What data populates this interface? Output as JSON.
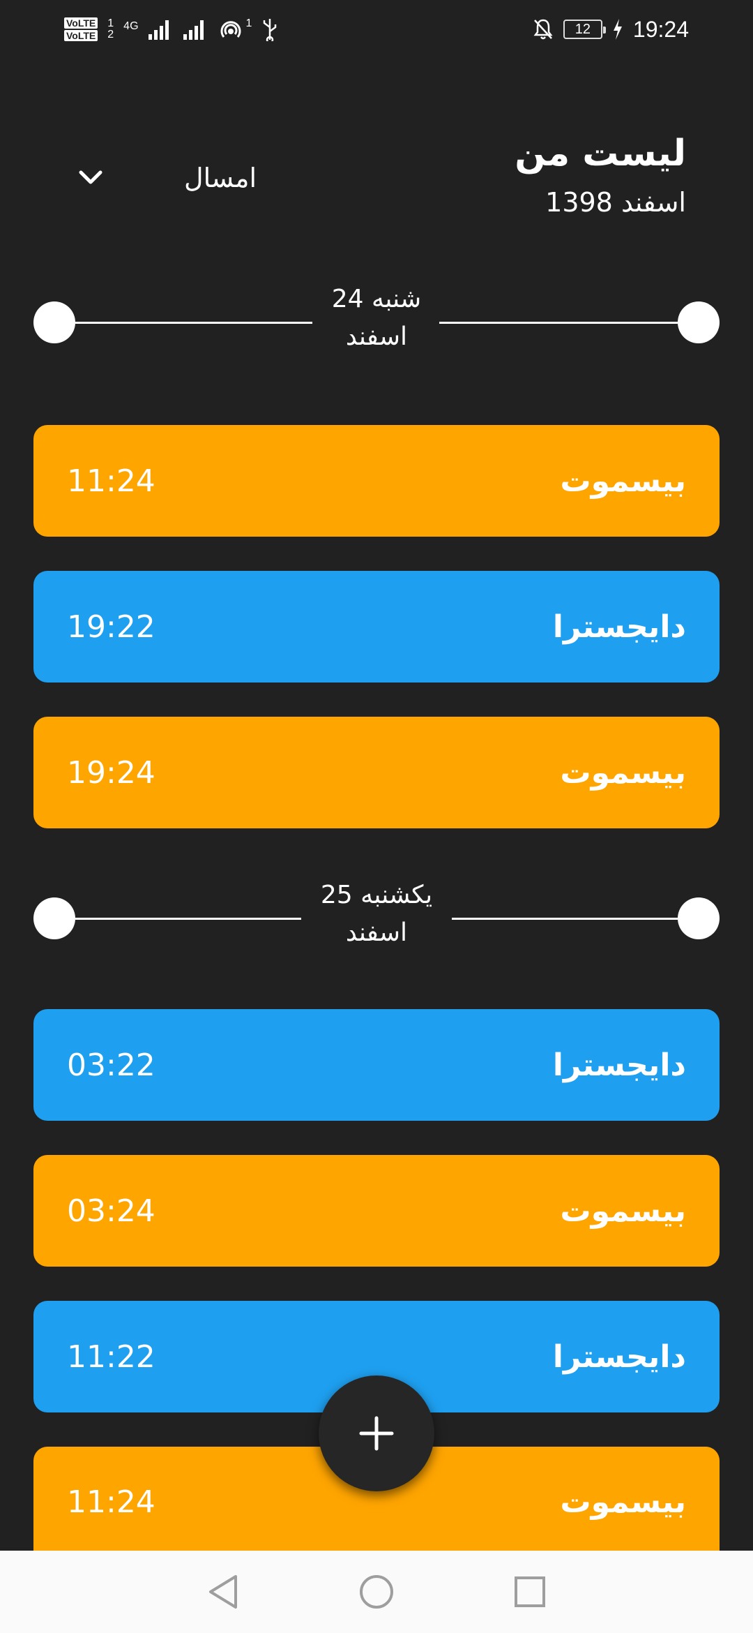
{
  "status_bar": {
    "volte_1": "VoLTE",
    "volte_2": "VoLTE",
    "sim1_index": "1",
    "sim2_index": "2",
    "network": "4G",
    "hotspot_count": "1",
    "battery": "12",
    "time": "19:24"
  },
  "header": {
    "title": "لیست من",
    "subtitle": "اسفند 1398",
    "range_label": "امسال"
  },
  "days": [
    {
      "label_line1": "شنبه 24",
      "label_line2": "اسفند",
      "items": [
        {
          "name": "بیسموت",
          "time": "11:24",
          "color": "#FFA500"
        },
        {
          "name": "دایجسترا",
          "time": "19:22",
          "color": "#1E9FEF"
        },
        {
          "name": "بیسموت",
          "time": "19:24",
          "color": "#FFA500"
        }
      ]
    },
    {
      "label_line1": "یکشنبه 25",
      "label_line2": "اسفند",
      "items": [
        {
          "name": "دایجسترا",
          "time": "03:22",
          "color": "#1E9FEF"
        },
        {
          "name": "بیسموت",
          "time": "03:24",
          "color": "#FFA500"
        },
        {
          "name": "دایجسترا",
          "time": "11:22",
          "color": "#1E9FEF"
        },
        {
          "name": "بیسموت",
          "time": "11:24",
          "color": "#FFA500"
        }
      ]
    }
  ],
  "colors": {
    "background": "#212121",
    "orange": "#FFA500",
    "blue": "#1E9FEF",
    "nav_bar": "#FAFAFA"
  },
  "icons": {
    "fab": "plus-icon",
    "range": "chevron-down-icon",
    "nav_back": "triangle-back-icon",
    "nav_home": "circle-home-icon",
    "nav_recents": "square-recents-icon"
  }
}
